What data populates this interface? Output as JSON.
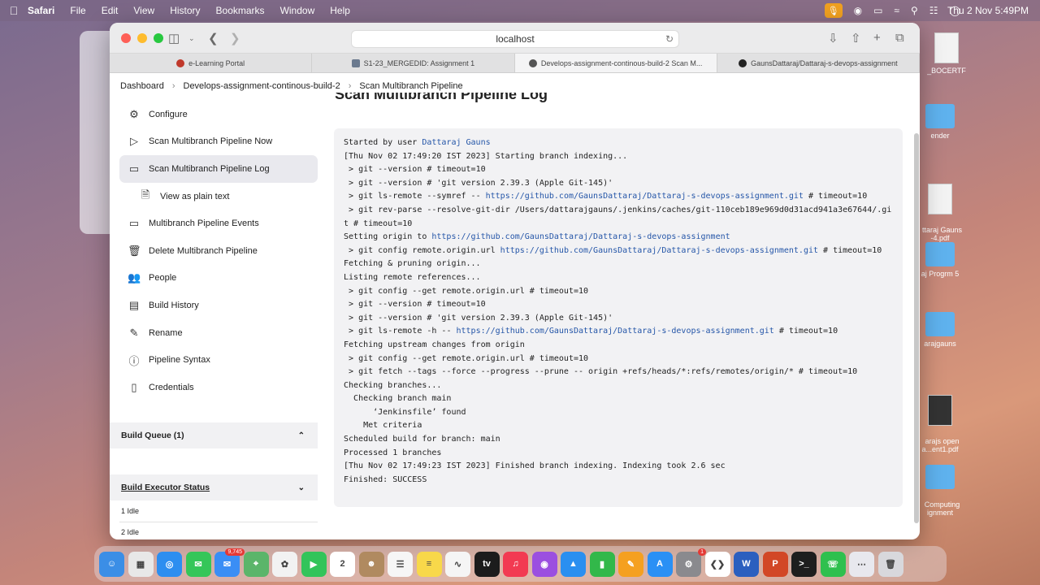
{
  "menubar": {
    "app": "Safari",
    "items": [
      "File",
      "Edit",
      "View",
      "History",
      "Bookmarks",
      "Window",
      "Help"
    ],
    "clock": "Thu 2 Nov  5:49PM"
  },
  "browser": {
    "url": "localhost",
    "tabs": [
      {
        "label": "e-Learning Portal",
        "color": "#c0392b"
      },
      {
        "label": "S1-23_MERGEDID: Assignment 1",
        "color": "#6b7a8f"
      },
      {
        "label": "Develops-assignment-continous-build-2 Scan M...",
        "color": "#555"
      },
      {
        "label": "GaunsDattaraj/Dattaraj-s-devops-assignment",
        "color": "#222"
      }
    ]
  },
  "breadcrumb": {
    "items": [
      "Dashboard",
      "Develops-assignment-continous-build-2",
      "Scan Multibranch Pipeline"
    ]
  },
  "page": {
    "heading": "Scan Multibranch Pipeline Log"
  },
  "sidebar": {
    "items": [
      {
        "label": "Configure",
        "icon": "gear-icon"
      },
      {
        "label": "Scan Multibranch Pipeline Now",
        "icon": "play-icon"
      },
      {
        "label": "Scan Multibranch Pipeline Log",
        "icon": "terminal-icon"
      },
      {
        "label": "View as plain text",
        "icon": "document-icon"
      },
      {
        "label": "Multibranch Pipeline Events",
        "icon": "terminal-icon"
      },
      {
        "label": "Delete Multibranch Pipeline",
        "icon": "trash-icon"
      },
      {
        "label": "People",
        "icon": "people-icon"
      },
      {
        "label": "Build History",
        "icon": "history-icon"
      },
      {
        "label": "Rename",
        "icon": "pencil-icon"
      },
      {
        "label": "Pipeline Syntax",
        "icon": "help-icon"
      },
      {
        "label": "Credentials",
        "icon": "phone-icon"
      }
    ],
    "build_queue": "Build Queue (1)",
    "executor_status": "Build Executor Status",
    "executors": [
      "1  Idle",
      "2  Idle"
    ]
  },
  "console": {
    "lines": [
      {
        "text": "Started by user ",
        "link": "Dattaraj Gauns",
        "after": ""
      },
      {
        "text": "[Thu Nov 02 17:49:20 IST 2023] Starting branch indexing..."
      },
      {
        "text": " > git --version # timeout=10"
      },
      {
        "text": " > git --version # 'git version 2.39.3 (Apple Git-145)'"
      },
      {
        "text": " > git ls-remote --symref -- ",
        "link": "https://github.com/GaunsDattaraj/Dattaraj-s-devops-assignment.git",
        "after": " # timeout=10"
      },
      {
        "text": " > git rev-parse --resolve-git-dir /Users/dattarajgauns/.jenkins/caches/git-110ceb189e969d0d31acd941a3e67644/.git # timeout=10"
      },
      {
        "text": "Setting origin to ",
        "link": "https://github.com/GaunsDattaraj/Dattaraj-s-devops-assignment",
        "after": ""
      },
      {
        "text": " > git config remote.origin.url ",
        "link": "https://github.com/GaunsDattaraj/Dattaraj-s-devops-assignment.git",
        "after": " # timeout=10"
      },
      {
        "text": "Fetching & pruning origin..."
      },
      {
        "text": "Listing remote references..."
      },
      {
        "text": " > git config --get remote.origin.url # timeout=10"
      },
      {
        "text": " > git --version # timeout=10"
      },
      {
        "text": " > git --version # 'git version 2.39.3 (Apple Git-145)'"
      },
      {
        "text": " > git ls-remote -h -- ",
        "link": "https://github.com/GaunsDattaraj/Dattaraj-s-devops-assignment.git",
        "after": " # timeout=10"
      },
      {
        "text": "Fetching upstream changes from origin"
      },
      {
        "text": " > git config --get remote.origin.url # timeout=10"
      },
      {
        "text": " > git fetch --tags --force --progress --prune -- origin +refs/heads/*:refs/remotes/origin/* # timeout=10"
      },
      {
        "text": "Checking branches..."
      },
      {
        "text": "  Checking branch main"
      },
      {
        "text": "      ‘Jenkinsfile’ found"
      },
      {
        "text": "    Met criteria"
      },
      {
        "text": "Scheduled build for branch: main"
      },
      {
        "text": "Processed 1 branches"
      },
      {
        "text": "[Thu Nov 02 17:49:23 IST 2023] Finished branch indexing. Indexing took 2.6 sec"
      },
      {
        "text": "Finished: SUCCESS"
      }
    ]
  },
  "desktop": {
    "items": [
      "_BOCERTF",
      "ender",
      "ttaraj Gauns\n-4.pdf",
      "aj Progrm 5",
      "arajgauns",
      "arajs open\na...ent1.pdf",
      "Computing\nignment"
    ]
  },
  "dock": {
    "apps": [
      {
        "name": "finder-icon",
        "color": "#3b8ee6",
        "glyph": "☺"
      },
      {
        "name": "launchpad-icon",
        "color": "#e8e8e8",
        "glyph": "▦"
      },
      {
        "name": "safari-icon",
        "color": "#2d8ef0",
        "glyph": "◎"
      },
      {
        "name": "messages-icon",
        "color": "#35c659",
        "glyph": "✉"
      },
      {
        "name": "mail-icon",
        "color": "#3a8ef5",
        "glyph": "✉",
        "badge": "9,745"
      },
      {
        "name": "maps-icon",
        "color": "#5bb56a",
        "glyph": "⌖"
      },
      {
        "name": "photos-icon",
        "color": "#f2f2f2",
        "glyph": "✿"
      },
      {
        "name": "facetime-icon",
        "color": "#32c45a",
        "glyph": "▶"
      },
      {
        "name": "calendar-icon",
        "color": "#ffffff",
        "glyph": "2"
      },
      {
        "name": "contacts-icon",
        "color": "#b08a60",
        "glyph": "☻"
      },
      {
        "name": "reminders-icon",
        "color": "#f6f6f6",
        "glyph": "☰"
      },
      {
        "name": "notes-icon",
        "color": "#f8d84a",
        "glyph": "≡"
      },
      {
        "name": "freeform-icon",
        "color": "#f5f5f5",
        "glyph": "∿"
      },
      {
        "name": "appletv-icon",
        "color": "#1c1c1c",
        "glyph": "tv"
      },
      {
        "name": "music-icon",
        "color": "#f23a52",
        "glyph": "♫"
      },
      {
        "name": "podcasts-icon",
        "color": "#9b4fe0",
        "glyph": "◉"
      },
      {
        "name": "keynote-icon",
        "color": "#2a8ff0",
        "glyph": "▲"
      },
      {
        "name": "numbers-icon",
        "color": "#32b84a",
        "glyph": "▮"
      },
      {
        "name": "pages-icon",
        "color": "#f5a020",
        "glyph": "✎"
      },
      {
        "name": "appstore-icon",
        "color": "#2a90f5",
        "glyph": "A"
      },
      {
        "name": "settings-icon",
        "color": "#8a8a8e",
        "glyph": "⚙",
        "badge": "1"
      },
      {
        "name": "vscode-icon",
        "color": "#ffffff",
        "glyph": "❮❯"
      },
      {
        "name": "word-icon",
        "color": "#2b5fbf",
        "glyph": "W"
      },
      {
        "name": "powerpoint-icon",
        "color": "#d24726",
        "glyph": "P"
      },
      {
        "name": "terminal-icon",
        "color": "#1e1e1e",
        "glyph": ">_"
      },
      {
        "name": "whatsapp-icon",
        "color": "#2fc04e",
        "glyph": "☏"
      },
      {
        "name": "downloads-icon",
        "color": "#e8e8ee",
        "glyph": "⋯"
      },
      {
        "name": "trash-icon",
        "color": "#d8d8dc",
        "glyph": "🗑"
      }
    ]
  }
}
